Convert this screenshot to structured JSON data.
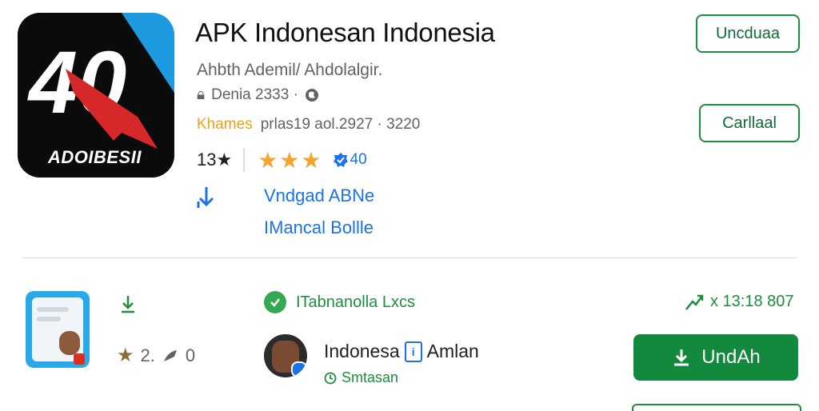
{
  "app": {
    "title": "APK Indonesan Indonesia",
    "developer": "Ahbth Ademil/ Ahdolalgir.",
    "meta": "Denia 2333 ·",
    "version_tag": "Khames",
    "version_text": "prlas19 aol.2927 · 3220",
    "rating": "13★",
    "stars": "★★★",
    "badge": "40",
    "brand_text": "ADOIBESII",
    "link1": "Vndgad  ABNe",
    "link2": "IMancal Bollle"
  },
  "actions": {
    "button1": "Uncduaa",
    "button2": "Carllaal"
  },
  "bottom": {
    "stat": "2.",
    "stat_suffix": "0",
    "feature": "ITabnanolla Lxcs",
    "author": "Indonesa",
    "author_suffix": "Amlan",
    "author_sub": "Smtasan",
    "right_stat": "x 13:18 807",
    "primary_button": "UndAh"
  },
  "colors": {
    "accent_green": "#12893c",
    "link_blue": "#1a73e8",
    "star_gold": "#f4a42b",
    "icon_blue": "#1e9ae0"
  }
}
